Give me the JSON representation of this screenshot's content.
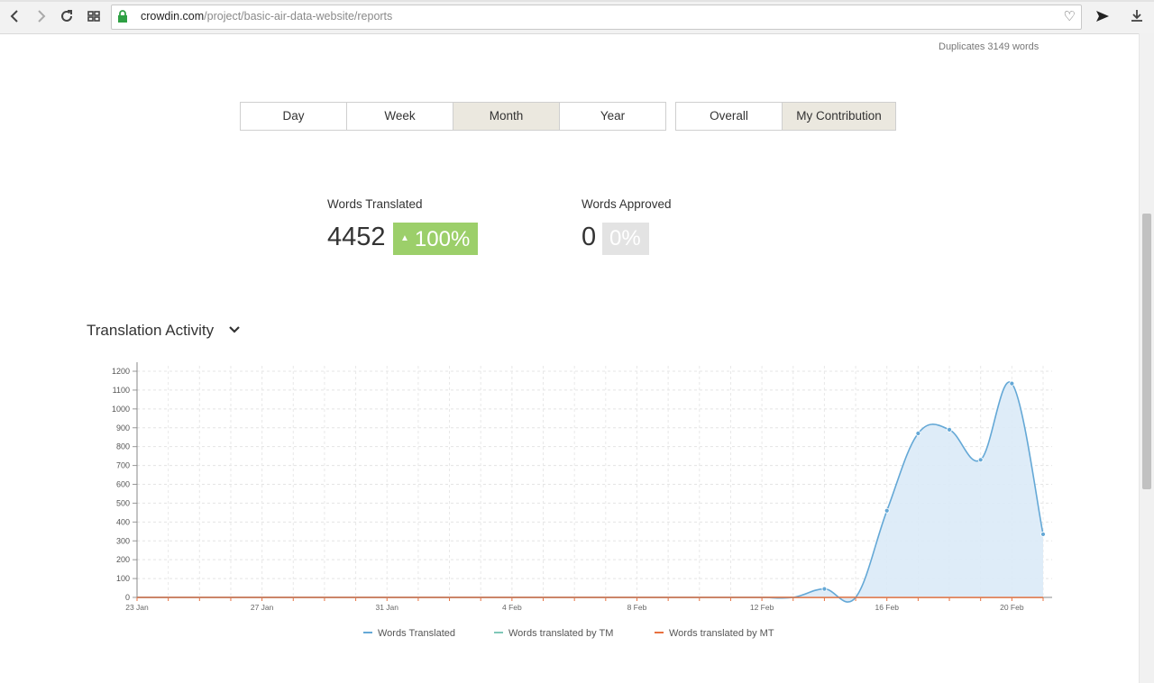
{
  "browser": {
    "url_domain": "crowdin.com",
    "url_path": "/project/basic-air-data-website/reports"
  },
  "summary": {
    "duplicates": "Duplicates 3149 words"
  },
  "period_buttons": [
    {
      "label": "Day",
      "active": false
    },
    {
      "label": "Week",
      "active": false
    },
    {
      "label": "Month",
      "active": true
    },
    {
      "label": "Year",
      "active": false
    }
  ],
  "scope_buttons": [
    {
      "label": "Overall",
      "active": false
    },
    {
      "label": "My Contribution",
      "active": true
    }
  ],
  "stats": {
    "translated": {
      "label": "Words Translated",
      "value": "4452",
      "percent": "100%"
    },
    "approved": {
      "label": "Words Approved",
      "value": "0",
      "percent": "0%"
    }
  },
  "section": {
    "title": "Translation Activity"
  },
  "colors": {
    "translated": "#64a8d6",
    "tm": "#7fc7b8",
    "mt": "#e8703f",
    "fill": "#daeaf7",
    "green": "#9ccf6a"
  },
  "chart_data": {
    "type": "area",
    "y_ticks": [
      0,
      100,
      200,
      300,
      400,
      500,
      600,
      700,
      800,
      900,
      1000,
      1100,
      1200
    ],
    "ylim": [
      0,
      1200
    ],
    "x_dates": [
      "23 Jan",
      "24 Jan",
      "25 Jan",
      "26 Jan",
      "27 Jan",
      "28 Jan",
      "29 Jan",
      "30 Jan",
      "31 Jan",
      "1 Feb",
      "2 Feb",
      "3 Feb",
      "4 Feb",
      "5 Feb",
      "6 Feb",
      "7 Feb",
      "8 Feb",
      "9 Feb",
      "10 Feb",
      "11 Feb",
      "12 Feb",
      "13 Feb",
      "14 Feb",
      "15 Feb",
      "16 Feb",
      "17 Feb",
      "18 Feb",
      "19 Feb",
      "20 Feb",
      "21 Feb"
    ],
    "x_tick_labels": [
      "23 Jan",
      "",
      "",
      "",
      "27 Jan",
      "",
      "",
      "",
      "31 Jan",
      "",
      "",
      "",
      "4 Feb",
      "",
      "",
      "",
      "8 Feb",
      "",
      "",
      "",
      "12 Feb",
      "",
      "",
      "",
      "16 Feb",
      "",
      "",
      "",
      "20 Feb",
      ""
    ],
    "series": [
      {
        "name": "Words Translated",
        "values": [
          0,
          0,
          0,
          0,
          0,
          0,
          0,
          0,
          0,
          0,
          0,
          0,
          0,
          0,
          0,
          0,
          0,
          0,
          0,
          0,
          0,
          0,
          45,
          0,
          460,
          870,
          890,
          730,
          1135,
          335
        ]
      },
      {
        "name": "Words translated by TM",
        "values": [
          0,
          0,
          0,
          0,
          0,
          0,
          0,
          0,
          0,
          0,
          0,
          0,
          0,
          0,
          0,
          0,
          0,
          0,
          0,
          0,
          0,
          0,
          0,
          0,
          0,
          0,
          0,
          0,
          0,
          0
        ]
      },
      {
        "name": "Words translated by MT",
        "values": [
          0,
          0,
          0,
          0,
          0,
          0,
          0,
          0,
          0,
          0,
          0,
          0,
          0,
          0,
          0,
          0,
          0,
          0,
          0,
          0,
          0,
          0,
          0,
          0,
          0,
          0,
          0,
          0,
          0,
          0
        ]
      }
    ],
    "grid": true,
    "legend": "bottom-center"
  }
}
